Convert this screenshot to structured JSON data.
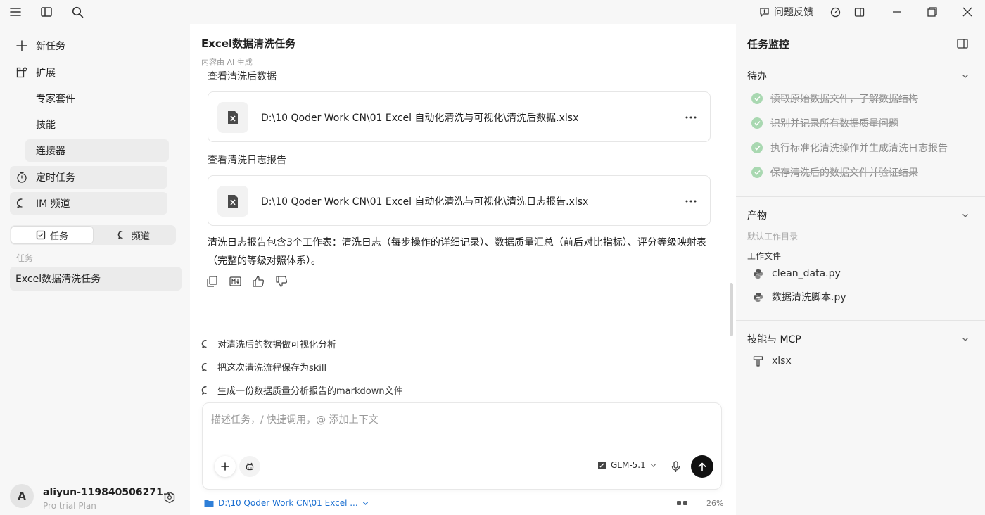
{
  "titlebar": {
    "feedback_label": "问题反馈"
  },
  "sidebar": {
    "nav": [
      {
        "label": "新任务",
        "icon": "plus-icon"
      },
      {
        "label": "扩展",
        "icon": "extensions-icon"
      },
      {
        "label": "专家套件"
      },
      {
        "label": "技能"
      },
      {
        "label": "连接器"
      },
      {
        "label": "定时任务",
        "icon": "timer-icon"
      },
      {
        "label": "IM 频道",
        "icon": "chat-bubble-icon"
      }
    ],
    "segment": {
      "tasks_label": "任务",
      "channels_label": "频道",
      "active": "任务"
    },
    "section_label": "任务",
    "task_items": [
      "Excel数据清洗任务"
    ],
    "user": {
      "avatar_letter": "A",
      "name": "aliyun-119840506271...",
      "plan": "Pro trial Plan"
    }
  },
  "main": {
    "title": "Excel数据清洗任务",
    "ai_note": "内容由 AI 生成",
    "caption1": "查看清洗后数据",
    "file1": "D:\\10 Qoder Work CN\\01 Excel 自动化清洗与可视化\\清洗后数据.xlsx",
    "caption2": "查看清洗日志报告",
    "file2": "D:\\10 Qoder Work CN\\01 Excel 自动化清洗与可视化\\清洗日志报告.xlsx",
    "summary": "清洗日志报告包含3个工作表：清洗日志（每步操作的详细记录）、数据质量汇总（前后对比指标）、评分等级映射表（完整的等级对照体系）。",
    "suggestions": [
      "对清洗后的数据做可视化分析",
      "把这次清洗流程保存为skill",
      "生成一份数据质量分析报告的markdown文件"
    ],
    "composer": {
      "placeholder": "描述任务，/ 快捷调用，@ 添加上下文",
      "model": "GLM-5.1"
    },
    "footer": {
      "folder": "D:\\10 Qoder Work CN\\01 Excel ...",
      "context_percent": "26%"
    }
  },
  "right_panel": {
    "title": "任务监控",
    "todo_label": "待办",
    "todos": [
      "读取原始数据文件，了解数据结构",
      "识别并记录所有数据质量问题",
      "执行标准化清洗操作并生成清洗日志报告",
      "保存清洗后的数据文件并验证结果"
    ],
    "artifacts_label": "产物",
    "default_dir_label": "默认工作目录",
    "work_files_label": "工作文件",
    "files": [
      "clean_data.py",
      "数据清洗脚本.py"
    ],
    "skills_label": "技能与 MCP",
    "skills": [
      "xlsx"
    ]
  },
  "colors": {
    "accent_link": "#1a6fd1",
    "check_green": "#a9d8b1",
    "send_button": "#111111"
  }
}
